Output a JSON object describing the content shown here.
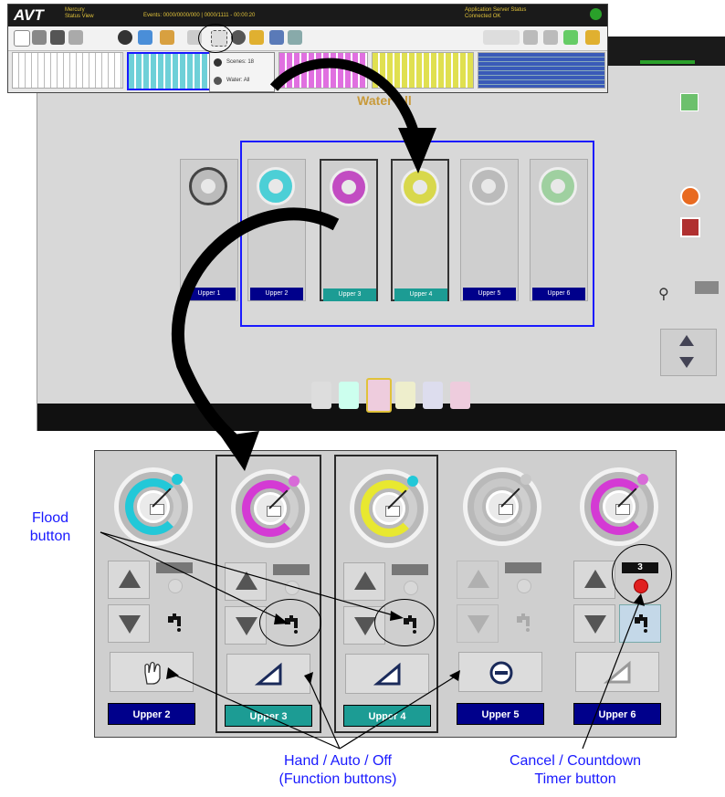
{
  "toolbar": {
    "logo": "AVT",
    "app_name_line1": "Mercury",
    "app_name_line2": "Status View",
    "events": "Events: 0000/0000/000 | 0000/1111 - 00:00:20",
    "server_line1": "Application Server Status",
    "server_line2": "Connected OK",
    "menu_items": [
      "Scenes: 18",
      "Water: All"
    ]
  },
  "main": {
    "title": "Water All",
    "columns": [
      {
        "label": "Upper 1",
        "style": "navy"
      },
      {
        "label": "Upper 2",
        "style": "navy"
      },
      {
        "label": "Upper 3",
        "style": "teal"
      },
      {
        "label": "Upper 4",
        "style": "teal"
      },
      {
        "label": "Upper 5",
        "style": "navy"
      },
      {
        "label": "Upper 6",
        "style": "navy"
      }
    ]
  },
  "zoom": {
    "zones": [
      {
        "label": "Upper 2",
        "style": "navy",
        "selected": false,
        "ring_color": "#22c8d8",
        "knob_color": "#22c8d8",
        "function": "hand"
      },
      {
        "label": "Upper 3",
        "style": "teal",
        "selected": true,
        "ring_color": "#d43ad4",
        "knob_color": "#d86ad8",
        "function": "auto"
      },
      {
        "label": "Upper 4",
        "style": "teal",
        "selected": true,
        "ring_color": "#e8e830",
        "knob_color": "#22c8d8",
        "function": "auto"
      },
      {
        "label": "Upper 5",
        "style": "navy",
        "selected": false,
        "ring_color": "#c8c8c8",
        "knob_color": "#c8c8c8",
        "function": "off"
      },
      {
        "label": "Upper 6",
        "style": "navy",
        "selected": false,
        "ring_color": "#d43ad4",
        "knob_color": "#d86ad8",
        "function": "auto-light"
      }
    ],
    "countdown_value": "3"
  },
  "callouts": {
    "flood_line1": "Flood",
    "flood_line2": "button",
    "hand_line1": "Hand / Auto / Off",
    "hand_line2": "(Function buttons)",
    "cancel_line1": "Cancel / Countdown",
    "cancel_line2": "Timer button"
  }
}
